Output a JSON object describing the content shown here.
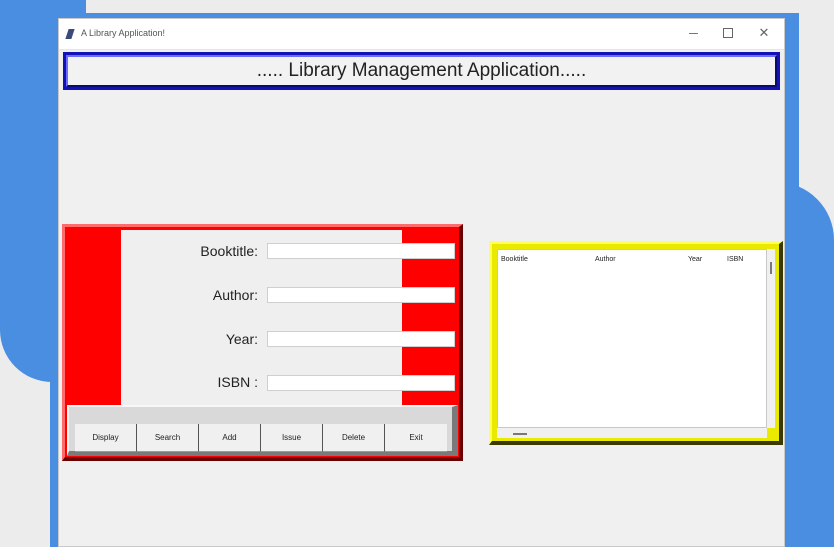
{
  "window": {
    "title": "A Library Application!",
    "controls": {
      "minimize": "—",
      "maximize": "☐",
      "close": "✕"
    }
  },
  "header": {
    "title": "..... Library Management Application....."
  },
  "form": {
    "fields": [
      {
        "label": "Booktitle:",
        "value": ""
      },
      {
        "label": "Author:",
        "value": ""
      },
      {
        "label": "Year:",
        "value": ""
      },
      {
        "label": "ISBN :",
        "value": ""
      }
    ]
  },
  "buttons": [
    "Display",
    "Search",
    "Add",
    "Issue",
    "Delete",
    "Exit"
  ],
  "results": {
    "columns": [
      "Booktitle",
      "Author",
      "Year",
      "ISBN"
    ]
  },
  "colors": {
    "form_panel": "#ff0000",
    "list_frame": "#eaea00",
    "header_border": "#1212b8",
    "background_decor": "#4a8ee2"
  }
}
